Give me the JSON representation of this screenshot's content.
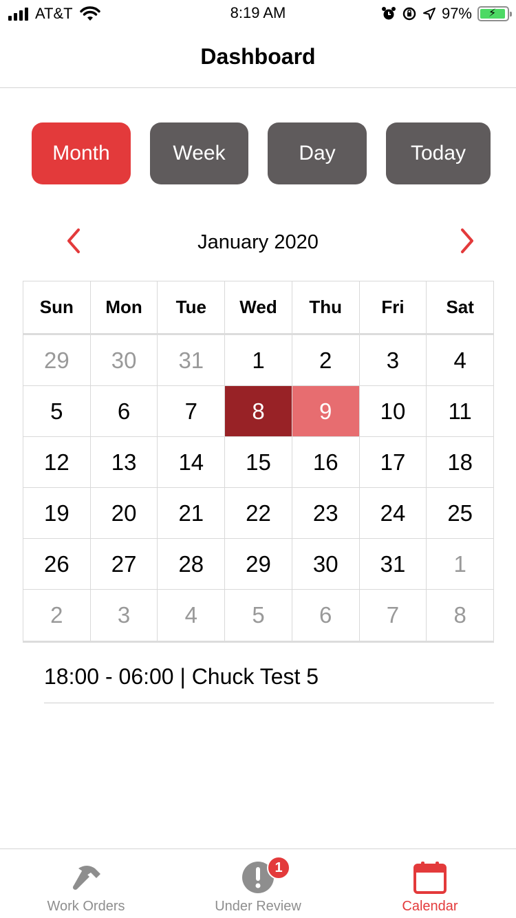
{
  "status_bar": {
    "carrier": "AT&T",
    "time": "8:19 AM",
    "battery_percent": "97%",
    "battery_level": 0.97,
    "icons": [
      "signal-icon",
      "wifi-icon",
      "alarm-icon",
      "orientation-lock-icon",
      "location-icon",
      "battery-icon"
    ]
  },
  "nav": {
    "title": "Dashboard"
  },
  "view_buttons": {
    "month": "Month",
    "week": "Week",
    "day": "Day",
    "today": "Today",
    "active": "month"
  },
  "calendar": {
    "month_title": "January 2020",
    "weekdays": [
      "Sun",
      "Mon",
      "Tue",
      "Wed",
      "Thu",
      "Fri",
      "Sat"
    ],
    "weeks": [
      [
        "29",
        "30",
        "31",
        "1",
        "2",
        "3",
        "4"
      ],
      [
        "5",
        "6",
        "7",
        "8",
        "9",
        "10",
        "11"
      ],
      [
        "12",
        "13",
        "14",
        "15",
        "16",
        "17",
        "18"
      ],
      [
        "19",
        "20",
        "21",
        "22",
        "23",
        "24",
        "25"
      ],
      [
        "26",
        "27",
        "28",
        "29",
        "30",
        "31",
        "1"
      ],
      [
        "2",
        "3",
        "4",
        "5",
        "6",
        "7",
        "8"
      ]
    ],
    "selected_day": "8",
    "today_day": "9",
    "colors": {
      "accent": "#e33a3b",
      "selected": "#982226",
      "today": "#e76d70",
      "muted": "#999999"
    }
  },
  "events": [
    {
      "text": "18:00 - 06:00 | Chuck Test 5"
    }
  ],
  "tab_bar": {
    "tabs": [
      {
        "label": "Work Orders",
        "icon": "hammer-icon"
      },
      {
        "label": "Under Review",
        "icon": "exclamation-icon",
        "badge": "1"
      },
      {
        "label": "Calendar",
        "icon": "calendar-icon"
      }
    ],
    "active": "Calendar"
  }
}
